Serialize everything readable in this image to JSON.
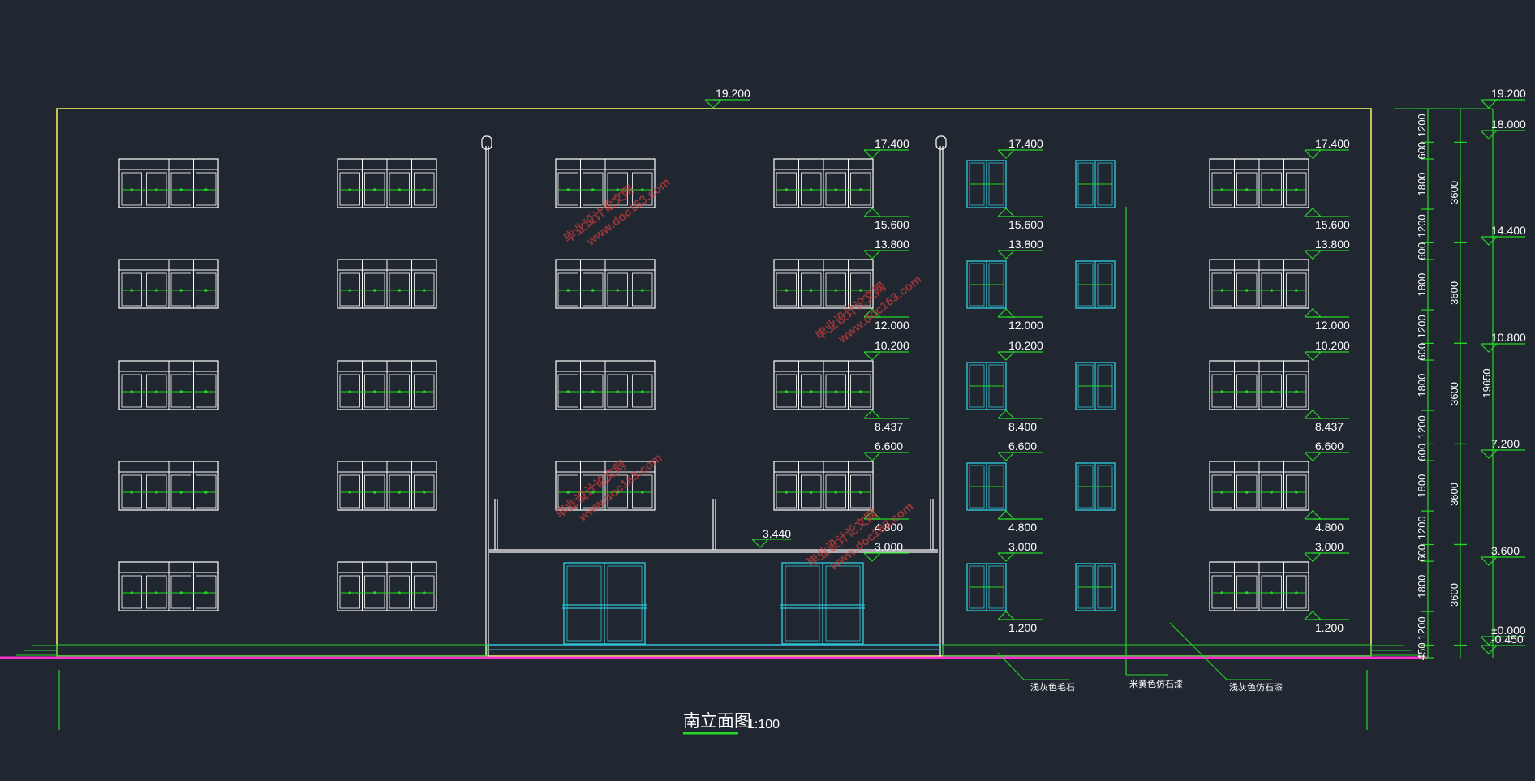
{
  "drawing": {
    "title": "南立面图",
    "scale": "1:100",
    "colors": {
      "background": "#212730",
      "outline": "#f5f56a",
      "lines": "#ffffff",
      "annotation": "#25d625",
      "glass": "#2ec4d4",
      "ground": "#ff33cc",
      "watermark": "#e04040"
    },
    "top_elevation": "19.200",
    "canopy_elevation": "3.440",
    "floor_levels_left": [
      {
        "top": "17.400",
        "bottom": "15.600"
      },
      {
        "top": "13.800",
        "bottom": "12.000"
      },
      {
        "top": "10.200",
        "bottom": "8.437"
      },
      {
        "top": "6.600",
        "bottom": "4.800"
      },
      {
        "top": "3.000",
        "bottom": ""
      }
    ],
    "floor_levels_mid": [
      {
        "top": "17.400",
        "bottom": "15.600"
      },
      {
        "top": "13.800",
        "bottom": "12.000"
      },
      {
        "top": "10.200",
        "bottom": "8.400"
      },
      {
        "top": "6.600",
        "bottom": "4.800"
      },
      {
        "top": "3.000",
        "bottom": "1.200"
      }
    ],
    "floor_levels_right": [
      {
        "top": "17.400",
        "bottom": "15.600"
      },
      {
        "top": "13.800",
        "bottom": "12.000"
      },
      {
        "top": "10.200",
        "bottom": "8.437"
      },
      {
        "top": "6.600",
        "bottom": "4.800"
      },
      {
        "top": "3.000",
        "bottom": "1.200"
      }
    ],
    "side_elevations": [
      "19.200",
      "18.000",
      "14.400",
      "10.800",
      "7.200",
      "3.600",
      "±0.000",
      "-0.450"
    ],
    "dim_segments": [
      "1200",
      "600",
      "1800",
      "1200",
      "600",
      "1800",
      "1200",
      "600",
      "1800",
      "1200",
      "600",
      "1800",
      "1200",
      "600",
      "1800",
      "1200",
      "450"
    ],
    "dim_floor_totals": [
      "3600",
      "3600",
      "3600",
      "3600",
      "3600"
    ],
    "dim_total": "19650",
    "material_notes": [
      "浅灰色毛石",
      "米黄色仿石漆",
      "浅灰色仿石漆"
    ],
    "watermark_site": "毕业设计论文网",
    "watermark_url": "www.doc163.com"
  }
}
